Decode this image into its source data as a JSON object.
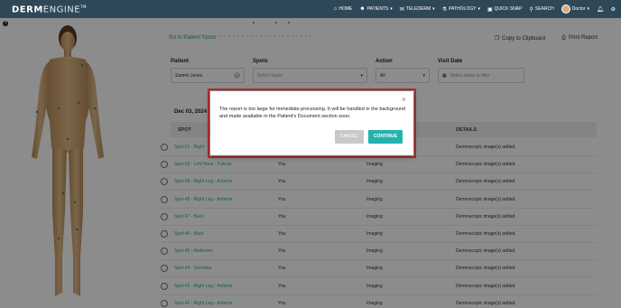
{
  "app": {
    "logo_bold": "DERM",
    "logo_light": "ENGINE",
    "logo_tm": "TM"
  },
  "nav": [
    {
      "label": "HOME",
      "icon": "home-icon"
    },
    {
      "label": "PATIENTS",
      "icon": "patients-icon",
      "dropdown": true
    },
    {
      "label": "TELEDERM",
      "icon": "telederm-icon",
      "dropdown": true
    },
    {
      "label": "PATHOLOGY",
      "icon": "pathology-icon",
      "dropdown": true
    },
    {
      "label": "QUICK SNAP",
      "icon": "quick-snap-icon"
    },
    {
      "label": "SEARCH",
      "icon": "search-icon"
    }
  ],
  "user": {
    "label": "Doctor"
  },
  "page": {
    "goto_patient_spots": "Go to Patient Spots",
    "copy_to_clipboard": "Copy to Clipboard",
    "print_report": "Print Report",
    "help": "?"
  },
  "filters": {
    "patient_label": "Patient",
    "patient_value": "Sammi Jones",
    "spots_label": "Spots",
    "spots_placeholder": "Select Spots",
    "action_label": "Action",
    "action_value": "All",
    "visit_date_label": "Visit Date",
    "visit_date_placeholder": "Select dates to filter"
  },
  "date_heading": "Dec 03, 2024",
  "table": {
    "headers": [
      "SPOT",
      "DETAILS"
    ],
    "rows": [
      {
        "spot": "Spot 51 - Right",
        "by": "",
        "action": "",
        "details": "Dermoscopic image(s) added."
      },
      {
        "spot": "Spot 50 - Left Hand - Palmar",
        "by": "You",
        "action": "Imaging",
        "details": "Dermoscopic image(s) added."
      },
      {
        "spot": "Spot 49 - Right Leg - Anterior",
        "by": "You",
        "action": "Imaging",
        "details": "Dermoscopic image(s) added."
      },
      {
        "spot": "Spot 48 - Right Leg - Anterior",
        "by": "You",
        "action": "Imaging",
        "details": "Dermoscopic image(s) added."
      },
      {
        "spot": "Spot 47 - Back",
        "by": "You",
        "action": "Imaging",
        "details": "Dermoscopic image(s) added."
      },
      {
        "spot": "Spot 46 - Back",
        "by": "You",
        "action": "Imaging",
        "details": "Dermoscopic image(s) added."
      },
      {
        "spot": "Spot 45 - Abdomen",
        "by": "You",
        "action": "Imaging",
        "details": "Dermoscopic image(s) added."
      },
      {
        "spot": "Spot 44 - Genitalia",
        "by": "You",
        "action": "Imaging",
        "details": "Dermoscopic image(s) added."
      },
      {
        "spot": "Spot 43 - Right Leg - Anterior",
        "by": "You",
        "action": "Imaging",
        "details": "Dermoscopic image(s) added."
      },
      {
        "spot": "Spot 42 - Right Leg - Anterior",
        "by": "You",
        "action": "Imaging",
        "details": "Dermoscopic image(s) added."
      }
    ]
  },
  "modal": {
    "message": "The report is too large for immediate processing. It will be handled in the background and made available in the Patient's Document section soon.",
    "close": "×",
    "cancel": "CANCEL",
    "continue": "CONTINUE"
  },
  "colors": {
    "nav_bg": "#2f4858",
    "accent": "#22b3ad",
    "link": "#2aa8a0",
    "modal_border": "#b42b2b"
  }
}
